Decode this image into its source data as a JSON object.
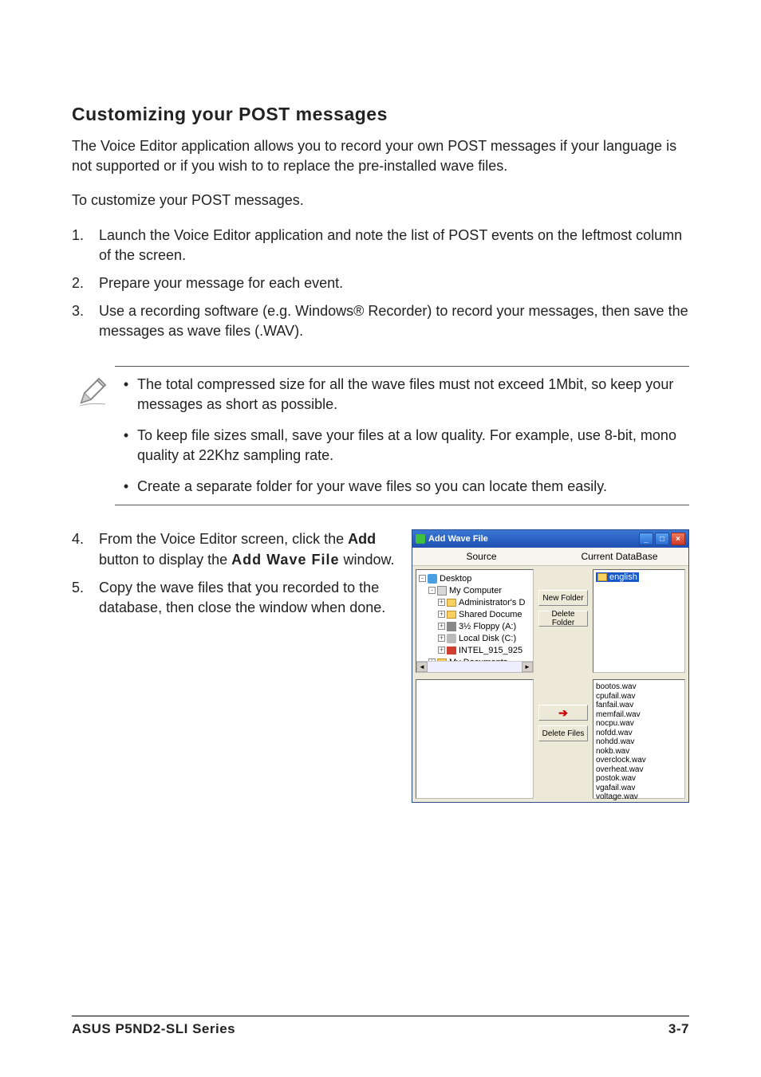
{
  "section_title": "Customizing your POST messages",
  "intro": "The Voice Editor application allows you to record your own POST messages if your language is not supported or if you wish to  to replace the pre-installed wave files.",
  "lead": "To customize your POST messages.",
  "steps_top": [
    "Launch the Voice Editor application and note the list of POST events on the leftmost column of the screen.",
    "Prepare your message for each event.",
    "Use a recording software (e.g. Windows® Recorder) to record your messages, then save the messages as wave files (.WAV)."
  ],
  "notes": [
    "The total compressed size for all the wave files must not exceed 1Mbit, so keep your messages as short as possible.",
    "To keep file sizes small, save your files at a low quality. For example, use 8-bit, mono quality at 22Khz sampling rate.",
    "Create a separate folder for your wave files so you can locate them easily."
  ],
  "step4": {
    "pre": "From the Voice Editor screen, click the ",
    "bold1": "Add",
    "mid": " button to display the ",
    "bold2": "Add Wave File",
    "post": " window."
  },
  "step5": "Copy the wave files that you recorded to the database, then close the window when done.",
  "footer": {
    "left": "ASUS P5ND2-SLI Series",
    "right": "3-7"
  },
  "window": {
    "title": "Add Wave File",
    "source_label": "Source",
    "db_label": "Current DataBase",
    "new_folder": "New Folder",
    "delete_folder": "Delete Folder",
    "delete_files": "Delete Files",
    "arrow": "➔",
    "tree": {
      "desktop": "Desktop",
      "mycomputer": "My Computer",
      "admin": "Administrator's D",
      "shared": "Shared Docume",
      "floppy": "3½ Floppy (A:)",
      "local": "Local Disk (C:)",
      "intel": "INTEL_915_925",
      "mydocs": "My Documents"
    },
    "db_selected": "english",
    "wavs": [
      "bootos.wav",
      "cpufail.wav",
      "fanfail.wav",
      "memfail.wav",
      "nocpu.wav",
      "nofdd.wav",
      "nohdd.wav",
      "nokb.wav",
      "overclock.wav",
      "overheat.wav",
      "postok.wav",
      "vgafail.wav",
      "voltage.wav"
    ]
  }
}
